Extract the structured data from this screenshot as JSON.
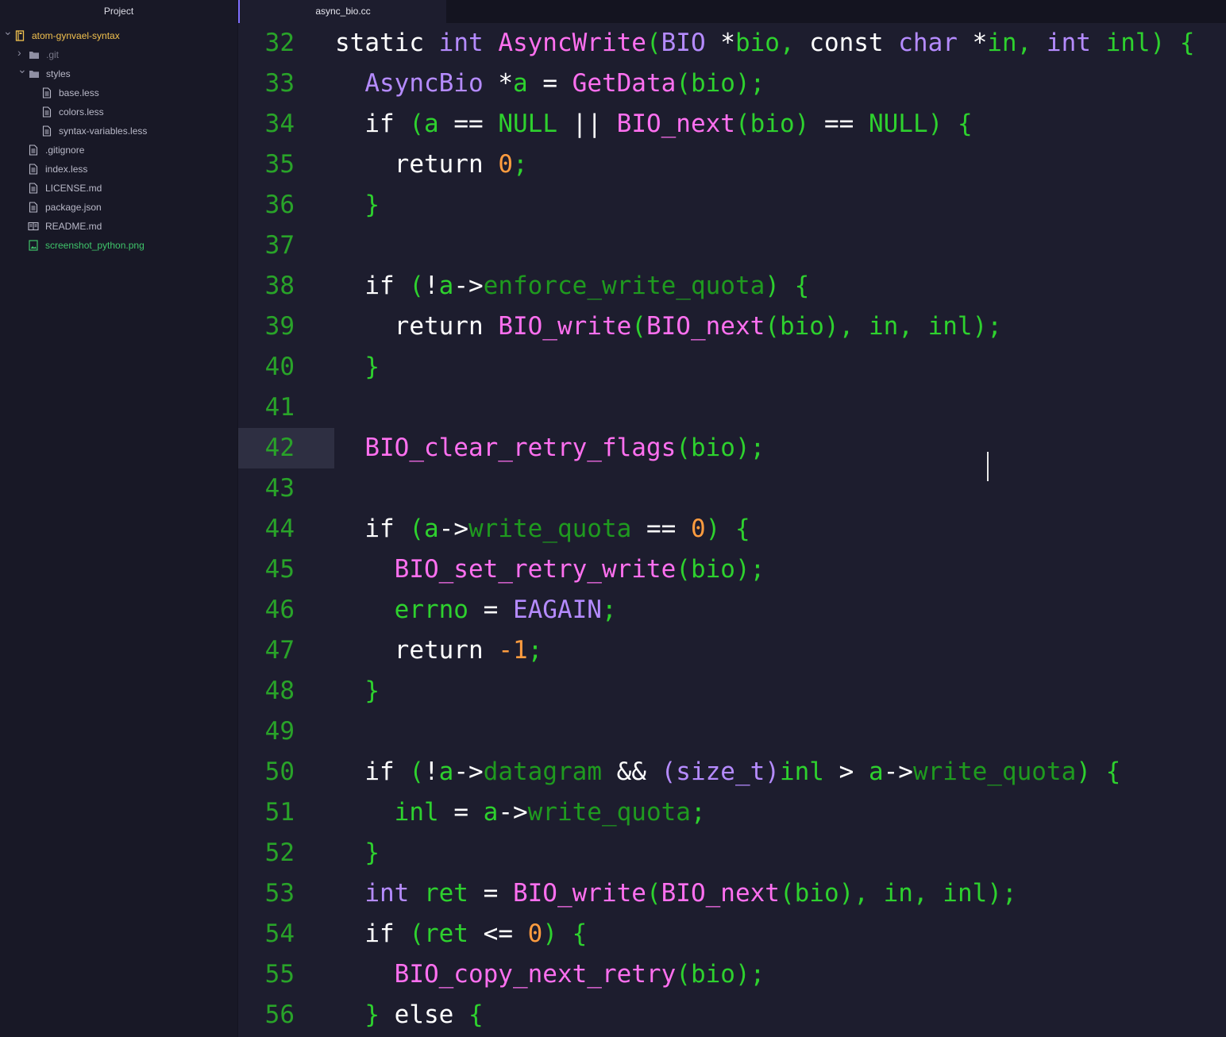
{
  "sidebar": {
    "title": "Project",
    "tree": [
      {
        "label": "atom-gynvael-syntax",
        "kind": "repo",
        "depth": 0,
        "expanded": true,
        "color": "#f2c14e",
        "icon": "repo-icon"
      },
      {
        "label": ".git",
        "kind": "folder",
        "depth": 1,
        "expanded": false,
        "color": "#777788",
        "icon": "folder-icon"
      },
      {
        "label": "styles",
        "kind": "folder",
        "depth": 1,
        "expanded": true,
        "color": "#b9b9c8",
        "icon": "folder-icon"
      },
      {
        "label": "base.less",
        "kind": "file",
        "depth": 2,
        "color": "#b9b9c8",
        "icon": "file-text-icon"
      },
      {
        "label": "colors.less",
        "kind": "file",
        "depth": 2,
        "color": "#b9b9c8",
        "icon": "file-text-icon"
      },
      {
        "label": "syntax-variables.less",
        "kind": "file",
        "depth": 2,
        "color": "#b9b9c8",
        "icon": "file-text-icon"
      },
      {
        "label": ".gitignore",
        "kind": "file",
        "depth": 1,
        "color": "#b9b9c8",
        "icon": "file-text-icon"
      },
      {
        "label": "index.less",
        "kind": "file",
        "depth": 1,
        "color": "#b9b9c8",
        "icon": "file-text-icon"
      },
      {
        "label": "LICENSE.md",
        "kind": "file",
        "depth": 1,
        "color": "#b9b9c8",
        "icon": "file-text-icon"
      },
      {
        "label": "package.json",
        "kind": "file",
        "depth": 1,
        "color": "#b9b9c8",
        "icon": "file-text-icon"
      },
      {
        "label": "README.md",
        "kind": "file",
        "depth": 1,
        "color": "#b9b9c8",
        "icon": "book-icon"
      },
      {
        "label": "screenshot_python.png",
        "kind": "file",
        "depth": 1,
        "color": "#3fc46a",
        "icon": "image-icon"
      }
    ]
  },
  "tabs": [
    {
      "label": "async_bio.cc",
      "active": true
    }
  ],
  "editor": {
    "cursor_line": 42,
    "colors": {
      "keyword": "#ffffff",
      "type": "#b58bff",
      "function": "#ff70f0",
      "variable": "#2ed12e",
      "number": "#ff9c3f",
      "member": "#1f9a1f",
      "line_number": "#29a329",
      "background": "#1d1d2e"
    },
    "lines": [
      {
        "n": "32",
        "tokens": [
          [
            "kw",
            "static "
          ],
          [
            "ty",
            "int "
          ],
          [
            "fn",
            "AsyncWrite"
          ],
          [
            "pun",
            "("
          ],
          [
            "ty",
            "BIO "
          ],
          [
            "op",
            "*"
          ],
          [
            "var",
            "bio"
          ],
          [
            "pun",
            ", "
          ],
          [
            "kw",
            "const "
          ],
          [
            "ty",
            "char "
          ],
          [
            "op",
            "*"
          ],
          [
            "var",
            "in"
          ],
          [
            "pun",
            ", "
          ],
          [
            "ty",
            "int "
          ],
          [
            "var",
            "inl"
          ],
          [
            "pun",
            ") {"
          ]
        ]
      },
      {
        "n": "33",
        "tokens": [
          [
            "ws",
            "  "
          ],
          [
            "ty",
            "AsyncBio "
          ],
          [
            "op",
            "*"
          ],
          [
            "var",
            "a"
          ],
          [
            "op",
            " = "
          ],
          [
            "fn",
            "GetData"
          ],
          [
            "pun",
            "("
          ],
          [
            "var",
            "bio"
          ],
          [
            "pun",
            ");"
          ]
        ]
      },
      {
        "n": "34",
        "tokens": [
          [
            "ws",
            "  "
          ],
          [
            "kw",
            "if "
          ],
          [
            "pun",
            "("
          ],
          [
            "var",
            "a"
          ],
          [
            "op",
            " == "
          ],
          [
            "var",
            "NULL "
          ],
          [
            "op",
            "|| "
          ],
          [
            "fn",
            "BIO_next"
          ],
          [
            "pun",
            "("
          ],
          [
            "var",
            "bio"
          ],
          [
            "pun",
            ")"
          ],
          [
            "op",
            " == "
          ],
          [
            "var",
            "NULL"
          ],
          [
            "pun",
            ") {"
          ]
        ]
      },
      {
        "n": "35",
        "tokens": [
          [
            "ws",
            "    "
          ],
          [
            "kw",
            "return "
          ],
          [
            "num",
            "0"
          ],
          [
            "pun",
            ";"
          ]
        ]
      },
      {
        "n": "36",
        "tokens": [
          [
            "ws",
            "  "
          ],
          [
            "pun",
            "}"
          ]
        ]
      },
      {
        "n": "37",
        "tokens": []
      },
      {
        "n": "38",
        "tokens": [
          [
            "ws",
            "  "
          ],
          [
            "kw",
            "if "
          ],
          [
            "pun",
            "("
          ],
          [
            "op",
            "!"
          ],
          [
            "var",
            "a"
          ],
          [
            "op",
            "->"
          ],
          [
            "mem",
            "enforce_write_quota"
          ],
          [
            "pun",
            ") {"
          ]
        ]
      },
      {
        "n": "39",
        "tokens": [
          [
            "ws",
            "    "
          ],
          [
            "kw",
            "return "
          ],
          [
            "fn",
            "BIO_write"
          ],
          [
            "pun",
            "("
          ],
          [
            "fn",
            "BIO_next"
          ],
          [
            "pun",
            "("
          ],
          [
            "var",
            "bio"
          ],
          [
            "pun",
            "), "
          ],
          [
            "var",
            "in"
          ],
          [
            "pun",
            ", "
          ],
          [
            "var",
            "inl"
          ],
          [
            "pun",
            ");"
          ]
        ]
      },
      {
        "n": "40",
        "tokens": [
          [
            "ws",
            "  "
          ],
          [
            "pun",
            "}"
          ]
        ]
      },
      {
        "n": "41",
        "tokens": []
      },
      {
        "n": "42",
        "tokens": [
          [
            "ws",
            "  "
          ],
          [
            "fn",
            "BIO_clear_retry_flags"
          ],
          [
            "pun",
            "("
          ],
          [
            "var",
            "bio"
          ],
          [
            "pun",
            ")"
          ],
          [
            "pun",
            ";"
          ]
        ]
      },
      {
        "n": "43",
        "tokens": []
      },
      {
        "n": "44",
        "tokens": [
          [
            "ws",
            "  "
          ],
          [
            "kw",
            "if "
          ],
          [
            "pun",
            "("
          ],
          [
            "var",
            "a"
          ],
          [
            "op",
            "->"
          ],
          [
            "mem",
            "write_quota"
          ],
          [
            "op",
            " == "
          ],
          [
            "num",
            "0"
          ],
          [
            "pun",
            ") {"
          ]
        ]
      },
      {
        "n": "45",
        "tokens": [
          [
            "ws",
            "    "
          ],
          [
            "fn",
            "BIO_set_retry_write"
          ],
          [
            "pun",
            "("
          ],
          [
            "var",
            "bio"
          ],
          [
            "pun",
            ");"
          ]
        ]
      },
      {
        "n": "46",
        "tokens": [
          [
            "ws",
            "    "
          ],
          [
            "var",
            "errno"
          ],
          [
            "op",
            " = "
          ],
          [
            "ty",
            "EAGAIN"
          ],
          [
            "pun",
            ";"
          ]
        ]
      },
      {
        "n": "47",
        "tokens": [
          [
            "ws",
            "    "
          ],
          [
            "kw",
            "return "
          ],
          [
            "num",
            "-1"
          ],
          [
            "pun",
            ";"
          ]
        ]
      },
      {
        "n": "48",
        "tokens": [
          [
            "ws",
            "  "
          ],
          [
            "pun",
            "}"
          ]
        ]
      },
      {
        "n": "49",
        "tokens": []
      },
      {
        "n": "50",
        "tokens": [
          [
            "ws",
            "  "
          ],
          [
            "kw",
            "if "
          ],
          [
            "pun",
            "("
          ],
          [
            "op",
            "!"
          ],
          [
            "var",
            "a"
          ],
          [
            "op",
            "->"
          ],
          [
            "mem",
            "datagram"
          ],
          [
            "op",
            " && "
          ],
          [
            "ty",
            "(size_t)"
          ],
          [
            "var",
            "inl"
          ],
          [
            "op",
            " > "
          ],
          [
            "var",
            "a"
          ],
          [
            "op",
            "->"
          ],
          [
            "mem",
            "write_quota"
          ],
          [
            "pun",
            ") {"
          ]
        ]
      },
      {
        "n": "51",
        "tokens": [
          [
            "ws",
            "    "
          ],
          [
            "var",
            "inl"
          ],
          [
            "op",
            " = "
          ],
          [
            "var",
            "a"
          ],
          [
            "op",
            "->"
          ],
          [
            "mem",
            "write_quota"
          ],
          [
            "pun",
            ";"
          ]
        ]
      },
      {
        "n": "52",
        "tokens": [
          [
            "ws",
            "  "
          ],
          [
            "pun",
            "}"
          ]
        ]
      },
      {
        "n": "53",
        "tokens": [
          [
            "ws",
            "  "
          ],
          [
            "ty",
            "int "
          ],
          [
            "var",
            "ret"
          ],
          [
            "op",
            " = "
          ],
          [
            "fn",
            "BIO_write"
          ],
          [
            "pun",
            "("
          ],
          [
            "fn",
            "BIO_next"
          ],
          [
            "pun",
            "("
          ],
          [
            "var",
            "bio"
          ],
          [
            "pun",
            "), "
          ],
          [
            "var",
            "in"
          ],
          [
            "pun",
            ", "
          ],
          [
            "var",
            "inl"
          ],
          [
            "pun",
            ");"
          ]
        ]
      },
      {
        "n": "54",
        "tokens": [
          [
            "ws",
            "  "
          ],
          [
            "kw",
            "if "
          ],
          [
            "pun",
            "("
          ],
          [
            "var",
            "ret"
          ],
          [
            "op",
            " <= "
          ],
          [
            "num",
            "0"
          ],
          [
            "pun",
            ") {"
          ]
        ]
      },
      {
        "n": "55",
        "tokens": [
          [
            "ws",
            "    "
          ],
          [
            "fn",
            "BIO_copy_next_retry"
          ],
          [
            "pun",
            "("
          ],
          [
            "var",
            "bio"
          ],
          [
            "pun",
            ");"
          ]
        ]
      },
      {
        "n": "56",
        "tokens": [
          [
            "ws",
            "  "
          ],
          [
            "pun",
            "} "
          ],
          [
            "kw",
            "else "
          ],
          [
            "pun",
            "{"
          ]
        ]
      }
    ]
  }
}
